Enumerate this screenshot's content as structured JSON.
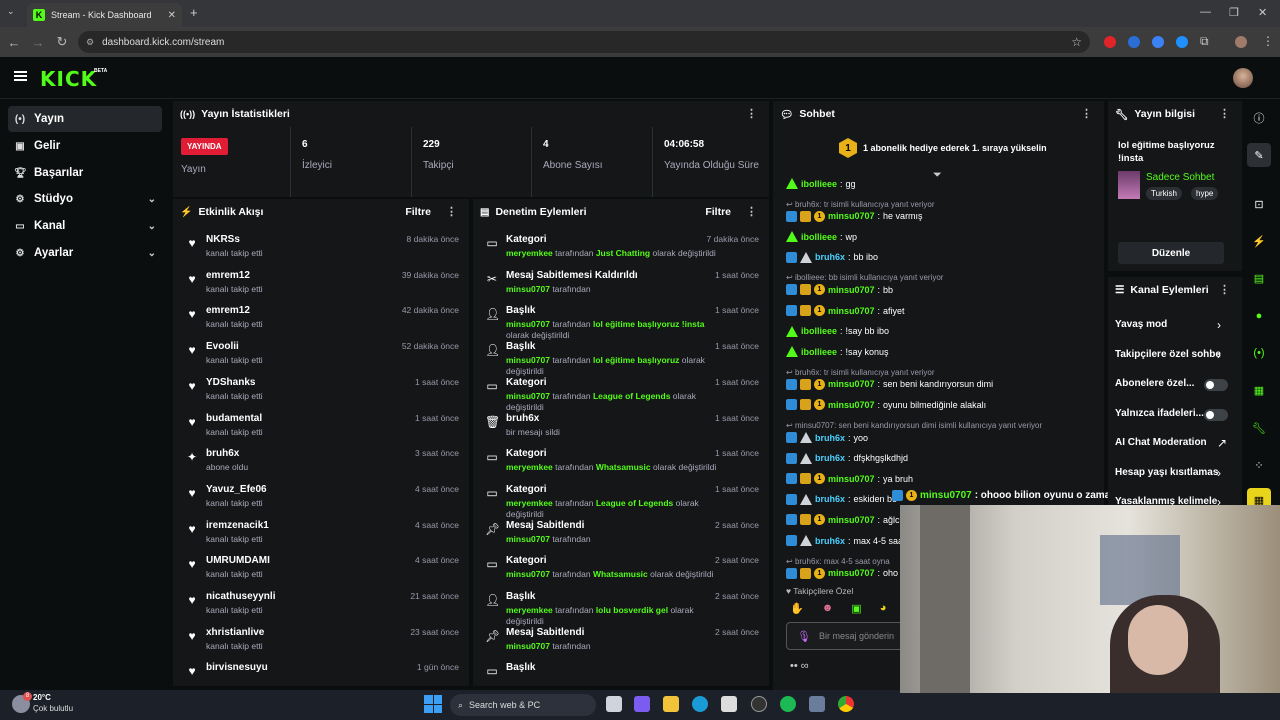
{
  "browser": {
    "tab_title": "Stream - Kick Dashboard",
    "url": "dashboard.kick.com/stream"
  },
  "header": {
    "logo": "KICK",
    "beta": "BETA"
  },
  "sidebar": {
    "items": [
      {
        "label": "Yayın",
        "icon": "broadcast-icon"
      },
      {
        "label": "Gelir",
        "icon": "money-icon"
      },
      {
        "label": "Başarılar",
        "icon": "trophy-icon"
      },
      {
        "label": "Stüdyo",
        "icon": "gear-icon"
      },
      {
        "label": "Kanal",
        "icon": "screen-icon"
      },
      {
        "label": "Ayarlar",
        "icon": "gear-icon"
      }
    ]
  },
  "stats": {
    "title": "Yayın İstatistikleri",
    "live_badge": "YAYINDA",
    "live_label": "Yayın",
    "items": [
      {
        "value": "6",
        "label": "İzleyici"
      },
      {
        "value": "229",
        "label": "Takipçi"
      },
      {
        "value": "4",
        "label": "Abone Sayısı"
      },
      {
        "value": "04:06:58",
        "label": "Yayında Olduğu Süre"
      }
    ]
  },
  "activity": {
    "title": "Etkinlik Akışı",
    "filter": "Filtre",
    "rows": [
      {
        "name": "NKRSs",
        "sub": "kanalı takip etti",
        "time": "8 dakika önce"
      },
      {
        "name": "emrem12",
        "sub": "kanalı takip etti",
        "time": "39 dakika önce"
      },
      {
        "name": "emrem12",
        "sub": "kanalı takip etti",
        "time": "42 dakika önce"
      },
      {
        "name": "Evoolii",
        "sub": "kanalı takip etti",
        "time": "52 dakika önce"
      },
      {
        "name": "YDShanks",
        "sub": "kanalı takip etti",
        "time": "1 saat önce"
      },
      {
        "name": "budamental",
        "sub": "kanalı takip etti",
        "time": "1 saat önce"
      },
      {
        "name": "bruh6x",
        "sub": "abone oldu",
        "time": "3 saat önce"
      },
      {
        "name": "Yavuz_Efe06",
        "sub": "kanalı takip etti",
        "time": "4 saat önce"
      },
      {
        "name": "iremzenacik1",
        "sub": "kanalı takip etti",
        "time": "4 saat önce"
      },
      {
        "name": "UMRUMDAMI",
        "sub": "kanalı takip etti",
        "time": "4 saat önce"
      },
      {
        "name": "nicathuseyynli",
        "sub": "kanalı takip etti",
        "time": "21 saat önce"
      },
      {
        "name": "xhristianlive",
        "sub": "kanalı takip etti",
        "time": "23 saat önce"
      },
      {
        "name": "birvisnesuyu",
        "sub": "",
        "time": "1 gün önce"
      }
    ]
  },
  "moderation": {
    "title": "Denetim Eylemleri",
    "filter": "Filtre",
    "rows": [
      {
        "name": "Kategori",
        "who": "meryemkee",
        "mid": " tarafından ",
        "hl": "Just Chatting",
        "end": " olarak değiştirildi",
        "time": "7 dakika önce"
      },
      {
        "name": "Mesaj Sabitlemesi Kaldırıldı",
        "who": "minsu0707",
        "mid": " tarafından",
        "hl": "",
        "end": "",
        "time": "1 saat önce"
      },
      {
        "name": "Başlık",
        "who": "minsu0707",
        "mid": " tarafından ",
        "hl": "lol eğitime başlıyoruz !insta",
        "end": " olarak değiştirildi",
        "time": "1 saat önce"
      },
      {
        "name": "Başlık",
        "who": "minsu0707",
        "mid": " tarafından ",
        "hl": "lol eğitime başlıyoruz",
        "end": " olarak değiştirildi",
        "time": "1 saat önce"
      },
      {
        "name": "Kategori",
        "who": "minsu0707",
        "mid": " tarafından ",
        "hl": "League of Legends",
        "end": " olarak değiştirildi",
        "time": "1 saat önce"
      },
      {
        "name": "bruh6x",
        "who": "",
        "mid": "bir mesajı sildi",
        "hl": "",
        "end": "",
        "time": "1 saat önce"
      },
      {
        "name": "Kategori",
        "who": "meryemkee",
        "mid": " tarafından ",
        "hl": "Whatsamusic",
        "end": " olarak değiştirildi",
        "time": "1 saat önce"
      },
      {
        "name": "Kategori",
        "who": "meryemkee",
        "mid": " tarafından ",
        "hl": "League of Legends",
        "end": " olarak değiştirildi",
        "time": "1 saat önce"
      },
      {
        "name": "Mesaj Sabitlendi",
        "who": "minsu0707",
        "mid": " tarafından",
        "hl": "",
        "end": "",
        "time": "2 saat önce"
      },
      {
        "name": "Kategori",
        "who": "minsu0707",
        "mid": " tarafından ",
        "hl": "Whatsamusic",
        "end": " olarak değiştirildi",
        "time": "2 saat önce"
      },
      {
        "name": "Başlık",
        "who": "meryemkee",
        "mid": " tarafından ",
        "hl": "lolu bosverdik gel",
        "end": " olarak değiştirildi",
        "time": "2 saat önce"
      },
      {
        "name": "Mesaj Sabitlendi",
        "who": "minsu0707",
        "mid": " tarafından",
        "hl": "",
        "end": "",
        "time": "2 saat önce"
      },
      {
        "name": "Başlık",
        "who": "",
        "mid": "",
        "hl": "",
        "end": "",
        "time": ""
      }
    ]
  },
  "chat": {
    "title": "Sohbet",
    "gift_count": "1",
    "gift_text": "1 abonelik hediye ederek 1. sıraya yükselin",
    "follower_only": "Takipçilere Özel",
    "input_placeholder": "Bir mesaj gönderin",
    "messages": [
      {
        "type": "msg",
        "user": "ibollieee",
        "text": "gg",
        "style": "g"
      },
      {
        "type": "reply",
        "text": "bruh6x: tr isimli kullanıcıya yanıt veriyor"
      },
      {
        "type": "msg",
        "user": "minsu0707",
        "text": "he varmış",
        "style": "b"
      },
      {
        "type": "msg",
        "user": "ibollieee",
        "text": "wp",
        "style": "g"
      },
      {
        "type": "msg",
        "user": "bruh6x",
        "text": "bb ibo",
        "style": "x"
      },
      {
        "type": "reply",
        "text": "ibollieee: bb isimli kullanıcıya yanıt veriyor"
      },
      {
        "type": "msg",
        "user": "minsu0707",
        "text": "bb",
        "style": "b"
      },
      {
        "type": "msg",
        "user": "minsu0707",
        "text": "afiyet",
        "style": "b"
      },
      {
        "type": "msg",
        "user": "ibollieee",
        "text": "!say bb ibo",
        "style": "g"
      },
      {
        "type": "msg",
        "user": "ibollieee",
        "text": "!say konuş",
        "style": "g"
      },
      {
        "type": "reply",
        "text": "bruh6x: tr isimli kullanıcıya yanıt veriyor"
      },
      {
        "type": "msg",
        "user": "minsu0707",
        "text": "sen beni kandırıyorsun dimi",
        "style": "b"
      },
      {
        "type": "msg",
        "user": "minsu0707",
        "text": "oyunu bilmediğinle alakalı",
        "style": "b"
      },
      {
        "type": "reply",
        "text": "minsu0707: sen beni kandırıyorsun dimi isimli kullanıcıya yanıt veriyor"
      },
      {
        "type": "msg",
        "user": "bruh6x",
        "text": "yoo",
        "style": "x"
      },
      {
        "type": "msg",
        "user": "bruh6x",
        "text": "dfşkhgşlkdhjd",
        "style": "x"
      },
      {
        "type": "msg",
        "user": "minsu0707",
        "text": "ya bruh",
        "style": "b"
      },
      {
        "type": "msg",
        "user": "bruh6x",
        "text": "eskiden be",
        "style": "x"
      },
      {
        "type": "msg",
        "user": "minsu0707",
        "text": "ağlc",
        "style": "b"
      },
      {
        "type": "msg",
        "user": "bruh6x",
        "text": "max 4-5 saa",
        "style": "x"
      },
      {
        "type": "reply",
        "text": "bruh6x: max 4-5 saat oyna"
      },
      {
        "type": "msg",
        "user": "minsu0707",
        "text": "oho",
        "style": "b"
      }
    ],
    "pinned_user": "minsu0707",
    "pinned_text": ": ohooo bilion oyunu o zaman"
  },
  "stream_info": {
    "title": "Yayın bilgisi",
    "stream_title": "lol eğitime başlıyoruz !insta",
    "category": "Sadece Sohbet",
    "tags": [
      "Turkish",
      "hype"
    ],
    "edit": "Düzenle"
  },
  "channel_actions": {
    "title": "Kanal Eylemleri",
    "items": [
      {
        "label": "Yavaş mod",
        "ctrl": "›"
      },
      {
        "label": "Takipçilere özel sohbe",
        "ctrl": "›"
      },
      {
        "label": "Abonelere özel...",
        "ctrl": "toggle"
      },
      {
        "label": "Yalnızca ifadeleri...",
        "ctrl": "toggle"
      },
      {
        "label": "AI Chat Moderation",
        "ctrl": "↗"
      },
      {
        "label": "Hesap yaşı kısıtlamas",
        "ctrl": "›"
      },
      {
        "label": "Yasaklanmış kelimele",
        "ctrl": "›"
      }
    ]
  },
  "taskbar": {
    "temp": "20°C",
    "weather": "Çok bulutlu",
    "weather_badge": "8",
    "search": "Search web & PC"
  }
}
